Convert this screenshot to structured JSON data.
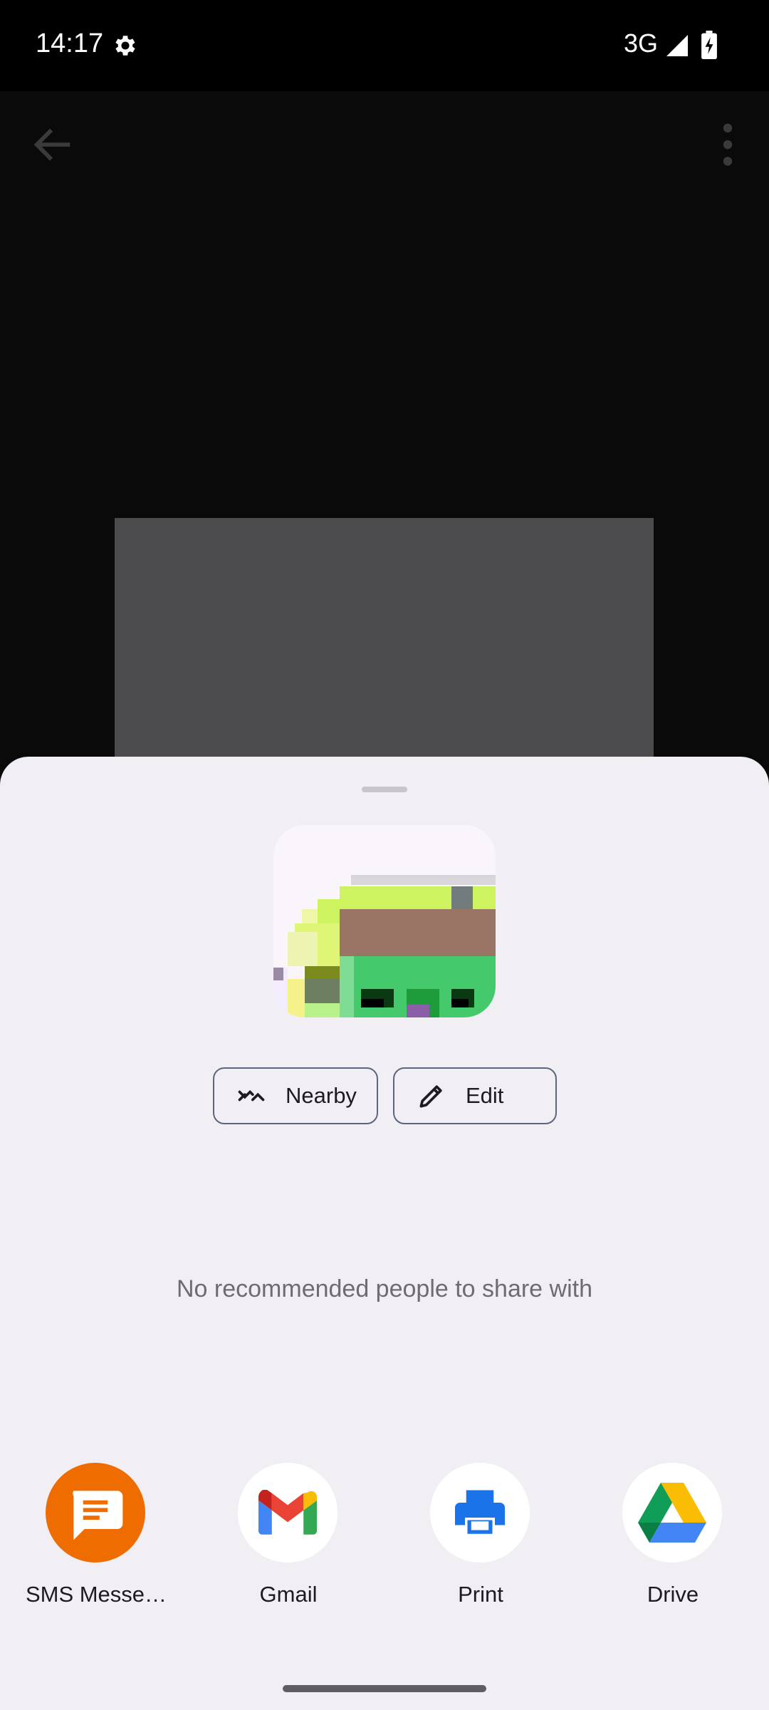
{
  "status_bar": {
    "time": "14:17",
    "network": "3G",
    "icons": [
      "gear-icon",
      "signal-icon",
      "battery-charging-icon"
    ]
  },
  "app_bar": {
    "icons": [
      "back-arrow-icon",
      "more-vert-icon"
    ]
  },
  "colors": {
    "sheet_bg": "#f1eff4",
    "sms_orange": "#ef6c00",
    "print_blue": "#1a73e8",
    "chip_border": "#5c6580"
  },
  "share_sheet": {
    "actions": [
      {
        "label": "Nearby",
        "icon": "nearby-share-icon"
      },
      {
        "label": "Edit",
        "icon": "pencil-icon"
      }
    ],
    "empty_message": "No recommended people to share with",
    "apps": [
      {
        "label": "SMS Messe…",
        "icon": "sms-messenger-icon"
      },
      {
        "label": "Gmail",
        "icon": "gmail-icon"
      },
      {
        "label": "Print",
        "icon": "print-icon"
      },
      {
        "label": "Drive",
        "icon": "drive-icon"
      }
    ]
  }
}
